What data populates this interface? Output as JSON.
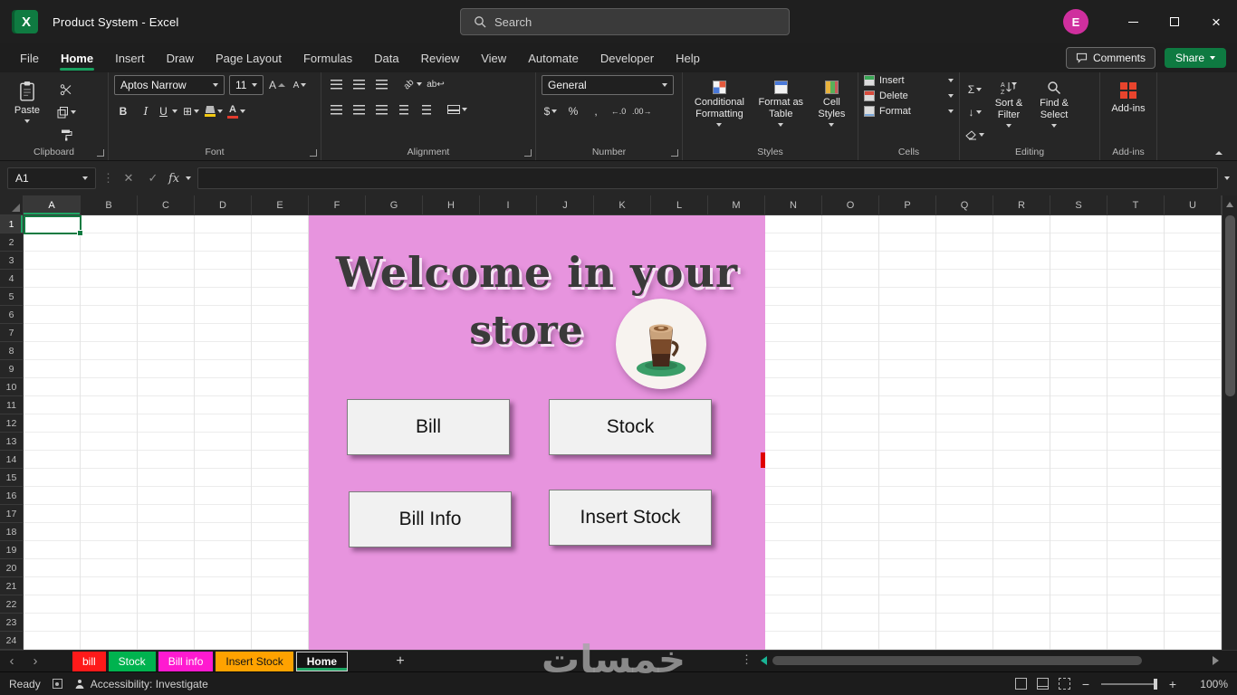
{
  "window": {
    "title": "Product System  -  Excel",
    "search_placeholder": "Search",
    "avatar_initial": "E"
  },
  "menu": {
    "tabs": [
      "File",
      "Home",
      "Insert",
      "Draw",
      "Page Layout",
      "Formulas",
      "Data",
      "Review",
      "View",
      "Automate",
      "Developer",
      "Help"
    ],
    "active_tab": "Home",
    "comments_label": "Comments",
    "share_label": "Share"
  },
  "ribbon": {
    "clipboard": {
      "group_label": "Clipboard",
      "paste_label": "Paste"
    },
    "font": {
      "group_label": "Font",
      "font_name": "Aptos Narrow",
      "font_size": "11",
      "bold_label": "B",
      "italic_label": "I",
      "underline_label": "U"
    },
    "alignment": {
      "group_label": "Alignment"
    },
    "number": {
      "group_label": "Number",
      "format_value": "General",
      "currency_label": "$",
      "percent_label": "%",
      "comma_label": ","
    },
    "styles": {
      "group_label": "Styles",
      "conditional_formatting_label": "Conditional Formatting",
      "format_as_table_label": "Format as Table",
      "cell_styles_label": "Cell Styles"
    },
    "cells": {
      "group_label": "Cells",
      "insert_label": "Insert",
      "delete_label": "Delete",
      "format_label": "Format"
    },
    "editing": {
      "group_label": "Editing",
      "autosum_label": "Σ",
      "sort_filter_label": "Sort & Filter",
      "find_select_label": "Find & Select"
    },
    "addins": {
      "group_label": "Add-ins",
      "button_label": "Add-ins"
    }
  },
  "formula_bar": {
    "name_box_value": "A1",
    "fx_label": "fx",
    "formula_value": ""
  },
  "grid": {
    "columns": [
      "A",
      "B",
      "C",
      "D",
      "E",
      "F",
      "G",
      "H",
      "I",
      "J",
      "K",
      "L",
      "M",
      "N",
      "O",
      "P",
      "Q",
      "R",
      "S",
      "T",
      "U"
    ],
    "rows": [
      "1",
      "2",
      "3",
      "4",
      "5",
      "6",
      "7",
      "8",
      "9",
      "10",
      "11",
      "12",
      "13",
      "14",
      "15",
      "16",
      "17",
      "18",
      "19",
      "20",
      "21",
      "22",
      "23",
      "24"
    ],
    "selected_cell": "A1"
  },
  "sheet_content": {
    "heading_line1": "Welcome in your",
    "heading_line2": "store",
    "background_color": "#e794de",
    "buttons": [
      "Bill",
      "Stock",
      "Bill Info",
      "Insert Stock"
    ]
  },
  "sheet_tabs": {
    "add_label": "+",
    "tabs": [
      {
        "name": "bill",
        "color": "#fe1a1a",
        "text_color": "#ffffff",
        "active": false
      },
      {
        "name": "Stock",
        "color": "#00b34f",
        "text_color": "#ffffff",
        "active": false
      },
      {
        "name": "Bill info",
        "color": "#ff1ad0",
        "text_color": "#ffffff",
        "active": false
      },
      {
        "name": "Insert Stock",
        "color": "#ffa200",
        "text_color": "#151515",
        "active": false
      },
      {
        "name": "Home",
        "color": "#1b1b1b",
        "text_color": "#ffffff",
        "active": true
      }
    ]
  },
  "status_bar": {
    "mode": "Ready",
    "accessibility": "Accessibility: Investigate",
    "zoom_level": "100%"
  },
  "watermark": "خمسات"
}
